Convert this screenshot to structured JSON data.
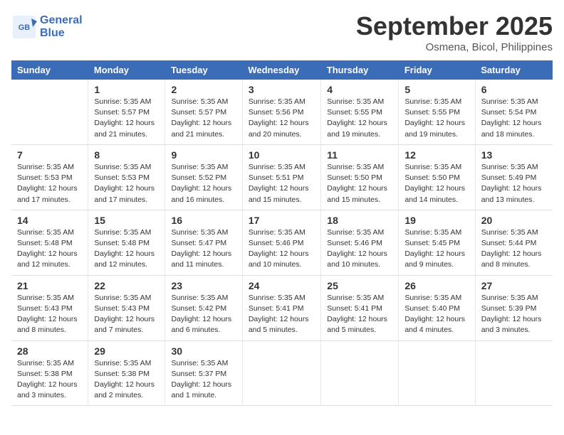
{
  "header": {
    "logo_text1": "General",
    "logo_text2": "Blue",
    "month": "September 2025",
    "location": "Osmena, Bicol, Philippines"
  },
  "days_of_week": [
    "Sunday",
    "Monday",
    "Tuesday",
    "Wednesday",
    "Thursday",
    "Friday",
    "Saturday"
  ],
  "weeks": [
    [
      {
        "day": "",
        "info": ""
      },
      {
        "day": "1",
        "info": "Sunrise: 5:35 AM\nSunset: 5:57 PM\nDaylight: 12 hours\nand 21 minutes."
      },
      {
        "day": "2",
        "info": "Sunrise: 5:35 AM\nSunset: 5:57 PM\nDaylight: 12 hours\nand 21 minutes."
      },
      {
        "day": "3",
        "info": "Sunrise: 5:35 AM\nSunset: 5:56 PM\nDaylight: 12 hours\nand 20 minutes."
      },
      {
        "day": "4",
        "info": "Sunrise: 5:35 AM\nSunset: 5:55 PM\nDaylight: 12 hours\nand 19 minutes."
      },
      {
        "day": "5",
        "info": "Sunrise: 5:35 AM\nSunset: 5:55 PM\nDaylight: 12 hours\nand 19 minutes."
      },
      {
        "day": "6",
        "info": "Sunrise: 5:35 AM\nSunset: 5:54 PM\nDaylight: 12 hours\nand 18 minutes."
      }
    ],
    [
      {
        "day": "7",
        "info": "Sunrise: 5:35 AM\nSunset: 5:53 PM\nDaylight: 12 hours\nand 17 minutes."
      },
      {
        "day": "8",
        "info": "Sunrise: 5:35 AM\nSunset: 5:53 PM\nDaylight: 12 hours\nand 17 minutes."
      },
      {
        "day": "9",
        "info": "Sunrise: 5:35 AM\nSunset: 5:52 PM\nDaylight: 12 hours\nand 16 minutes."
      },
      {
        "day": "10",
        "info": "Sunrise: 5:35 AM\nSunset: 5:51 PM\nDaylight: 12 hours\nand 15 minutes."
      },
      {
        "day": "11",
        "info": "Sunrise: 5:35 AM\nSunset: 5:50 PM\nDaylight: 12 hours\nand 15 minutes."
      },
      {
        "day": "12",
        "info": "Sunrise: 5:35 AM\nSunset: 5:50 PM\nDaylight: 12 hours\nand 14 minutes."
      },
      {
        "day": "13",
        "info": "Sunrise: 5:35 AM\nSunset: 5:49 PM\nDaylight: 12 hours\nand 13 minutes."
      }
    ],
    [
      {
        "day": "14",
        "info": "Sunrise: 5:35 AM\nSunset: 5:48 PM\nDaylight: 12 hours\nand 12 minutes."
      },
      {
        "day": "15",
        "info": "Sunrise: 5:35 AM\nSunset: 5:48 PM\nDaylight: 12 hours\nand 12 minutes."
      },
      {
        "day": "16",
        "info": "Sunrise: 5:35 AM\nSunset: 5:47 PM\nDaylight: 12 hours\nand 11 minutes."
      },
      {
        "day": "17",
        "info": "Sunrise: 5:35 AM\nSunset: 5:46 PM\nDaylight: 12 hours\nand 10 minutes."
      },
      {
        "day": "18",
        "info": "Sunrise: 5:35 AM\nSunset: 5:46 PM\nDaylight: 12 hours\nand 10 minutes."
      },
      {
        "day": "19",
        "info": "Sunrise: 5:35 AM\nSunset: 5:45 PM\nDaylight: 12 hours\nand 9 minutes."
      },
      {
        "day": "20",
        "info": "Sunrise: 5:35 AM\nSunset: 5:44 PM\nDaylight: 12 hours\nand 8 minutes."
      }
    ],
    [
      {
        "day": "21",
        "info": "Sunrise: 5:35 AM\nSunset: 5:43 PM\nDaylight: 12 hours\nand 8 minutes."
      },
      {
        "day": "22",
        "info": "Sunrise: 5:35 AM\nSunset: 5:43 PM\nDaylight: 12 hours\nand 7 minutes."
      },
      {
        "day": "23",
        "info": "Sunrise: 5:35 AM\nSunset: 5:42 PM\nDaylight: 12 hours\nand 6 minutes."
      },
      {
        "day": "24",
        "info": "Sunrise: 5:35 AM\nSunset: 5:41 PM\nDaylight: 12 hours\nand 5 minutes."
      },
      {
        "day": "25",
        "info": "Sunrise: 5:35 AM\nSunset: 5:41 PM\nDaylight: 12 hours\nand 5 minutes."
      },
      {
        "day": "26",
        "info": "Sunrise: 5:35 AM\nSunset: 5:40 PM\nDaylight: 12 hours\nand 4 minutes."
      },
      {
        "day": "27",
        "info": "Sunrise: 5:35 AM\nSunset: 5:39 PM\nDaylight: 12 hours\nand 3 minutes."
      }
    ],
    [
      {
        "day": "28",
        "info": "Sunrise: 5:35 AM\nSunset: 5:38 PM\nDaylight: 12 hours\nand 3 minutes."
      },
      {
        "day": "29",
        "info": "Sunrise: 5:35 AM\nSunset: 5:38 PM\nDaylight: 12 hours\nand 2 minutes."
      },
      {
        "day": "30",
        "info": "Sunrise: 5:35 AM\nSunset: 5:37 PM\nDaylight: 12 hours\nand 1 minute."
      },
      {
        "day": "",
        "info": ""
      },
      {
        "day": "",
        "info": ""
      },
      {
        "day": "",
        "info": ""
      },
      {
        "day": "",
        "info": ""
      }
    ]
  ]
}
